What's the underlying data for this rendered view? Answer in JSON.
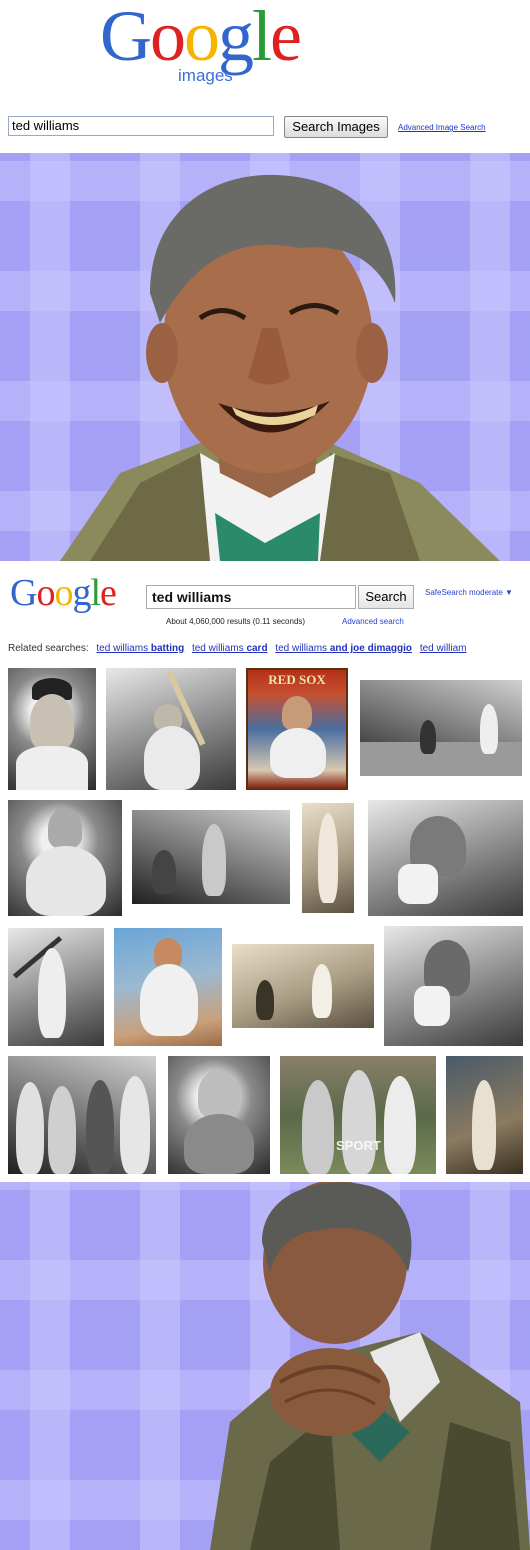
{
  "top": {
    "logo_letters": [
      {
        "ch": "G",
        "color": "#3366cc"
      },
      {
        "ch": "o",
        "color": "#dd2222"
      },
      {
        "ch": "o",
        "color": "#f5b400"
      },
      {
        "ch": "g",
        "color": "#3366cc"
      },
      {
        "ch": "l",
        "color": "#2a9b35"
      },
      {
        "ch": "e",
        "color": "#dd2222"
      }
    ],
    "logo_sub": "images",
    "search_value": "ted williams",
    "search_button": "Search Images",
    "advanced_link": "Advanced Image Search"
  },
  "results_header": {
    "search_value": "ted williams",
    "search_button": "Search",
    "safesearch": "SafeSearch moderate ▼",
    "result_stats": "About 4,060,000 results (0.11 seconds)",
    "advanced_link": "Advanced search"
  },
  "related": {
    "label": "Related searches:",
    "items": [
      {
        "plain": "ted williams ",
        "bold": "batting"
      },
      {
        "plain": "ted williams ",
        "bold": "card"
      },
      {
        "plain": "ted williams ",
        "bold": "and joe dimaggio"
      },
      {
        "plain": "ted william",
        "bold": ""
      }
    ]
  },
  "thumbnails": {
    "redsox_title": "RED SOX",
    "sport_label": "SPORT"
  },
  "colors": {
    "bg_purple": "#8c86f2",
    "link_blue": "#2233bb"
  }
}
